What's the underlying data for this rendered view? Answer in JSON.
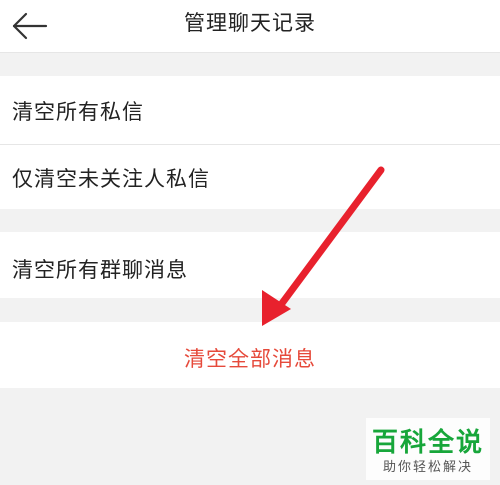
{
  "header": {
    "title": "管理聊天记录",
    "back_icon": "arrow-left-icon"
  },
  "section1": {
    "items": [
      {
        "label": "清空所有私信"
      },
      {
        "label": "仅清空未关注人私信"
      }
    ]
  },
  "section2": {
    "items": [
      {
        "label": "清空所有群聊消息"
      }
    ]
  },
  "danger_action": {
    "label": "清空全部消息",
    "color": "#e64a3b"
  },
  "annotation": {
    "arrow_color": "#e8212d",
    "icon": "red-arrow-icon"
  },
  "watermark": {
    "main": "百科全说",
    "sub": "助你轻松解决",
    "color": "#17a63a"
  }
}
